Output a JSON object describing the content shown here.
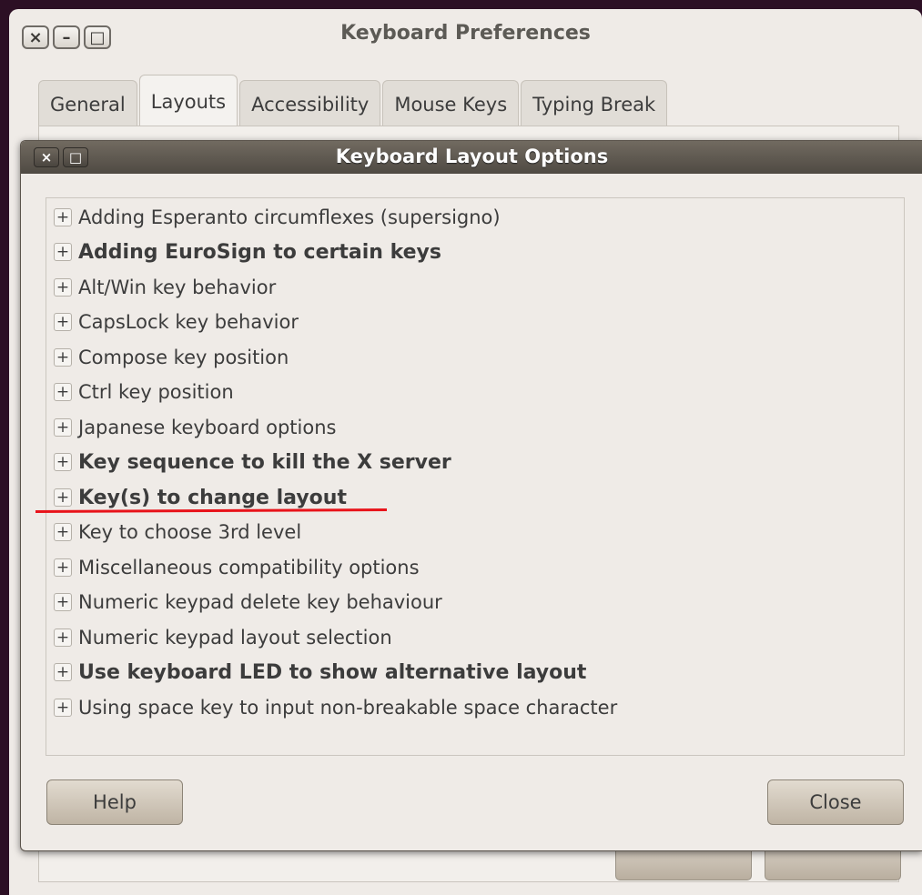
{
  "parent_window": {
    "title": "Keyboard Preferences",
    "tabs": [
      {
        "label": "General",
        "active": false
      },
      {
        "label": "Layouts",
        "active": true
      },
      {
        "label": "Accessibility",
        "active": false
      },
      {
        "label": "Mouse Keys",
        "active": false
      },
      {
        "label": "Typing Break",
        "active": false
      }
    ],
    "controls": {
      "close": "×",
      "minimize": "–",
      "maximize": "□"
    }
  },
  "dialog": {
    "title": "Keyboard Layout Options",
    "controls": {
      "close": "×",
      "maximize": "□"
    },
    "options": [
      {
        "label": "Adding Esperanto circumflexes (supersigno)",
        "bold": false
      },
      {
        "label": "Adding EuroSign to certain keys",
        "bold": true
      },
      {
        "label": "Alt/Win key behavior",
        "bold": false
      },
      {
        "label": "CapsLock key behavior",
        "bold": false
      },
      {
        "label": "Compose key position",
        "bold": false
      },
      {
        "label": "Ctrl key position",
        "bold": false
      },
      {
        "label": "Japanese keyboard options",
        "bold": false
      },
      {
        "label": "Key sequence to kill the X server",
        "bold": true
      },
      {
        "label": "Key(s) to change layout",
        "bold": true
      },
      {
        "label": "Key to choose 3rd level",
        "bold": false
      },
      {
        "label": "Miscellaneous compatibility options",
        "bold": false
      },
      {
        "label": "Numeric keypad delete key behaviour",
        "bold": false
      },
      {
        "label": "Numeric keypad layout selection",
        "bold": false
      },
      {
        "label": "Use keyboard LED to show alternative layout",
        "bold": true
      },
      {
        "label": "Using space key to input non-breakable space character",
        "bold": false
      }
    ],
    "expander_symbol": "+",
    "buttons": {
      "help": "Help",
      "close": "Close"
    }
  },
  "annotation_color": "#e8131a"
}
